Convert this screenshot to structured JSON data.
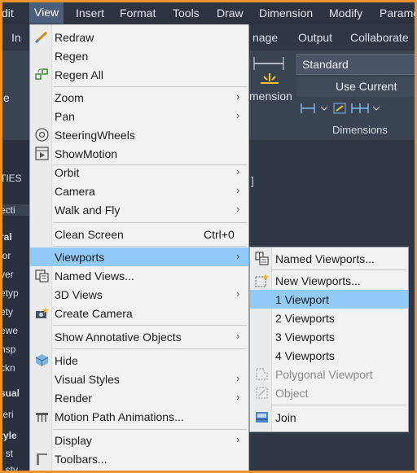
{
  "menubar": {
    "items": [
      "dit",
      "View",
      "Insert",
      "Format",
      "Tools",
      "Draw",
      "Dimension",
      "Modify",
      "Parame"
    ]
  },
  "ribbon_tabs": {
    "items": [
      "In",
      "nage",
      "Output",
      "Collaborate"
    ]
  },
  "ribbon": {
    "style_value": "Standard",
    "layer_value": "Use Current",
    "dimension_label": "mension",
    "panel_label": "Dimensions",
    "left_fragment": "e"
  },
  "left_palette": [
    "TIES",
    "ecti",
    "ral",
    "lor",
    "yer",
    "etyp",
    "ety",
    "ewe",
    "nsp",
    "ckn",
    "sual",
    "teri",
    "tyle",
    "t st",
    "t sty"
  ],
  "view_menu": {
    "items": [
      {
        "label": "Redraw",
        "icon": "redraw-icon"
      },
      {
        "label": "Regen"
      },
      {
        "label": "Regen All",
        "icon": "regen-all-icon"
      },
      {
        "label": "Zoom",
        "submenu": true
      },
      {
        "label": "Pan",
        "submenu": true
      },
      {
        "label": "SteeringWheels",
        "icon": "steeringwheels-icon"
      },
      {
        "label": "ShowMotion",
        "icon": "showmotion-icon"
      },
      {
        "label": "Orbit",
        "submenu": true
      },
      {
        "label": "Camera",
        "submenu": true
      },
      {
        "label": "Walk and Fly",
        "submenu": true
      },
      {
        "label": "Clean Screen",
        "shortcut": "Ctrl+0"
      },
      {
        "label": "Viewports",
        "submenu": true,
        "highlighted": true
      },
      {
        "label": "Named Views...",
        "icon": "named-views-icon"
      },
      {
        "label": "3D Views",
        "submenu": true
      },
      {
        "label": "Create Camera",
        "icon": "create-camera-icon"
      },
      {
        "label": "Show Annotative Objects",
        "submenu": true
      },
      {
        "label": "Hide",
        "icon": "hide-icon"
      },
      {
        "label": "Visual Styles",
        "submenu": true
      },
      {
        "label": "Render",
        "submenu": true
      },
      {
        "label": "Motion Path Animations...",
        "icon": "motion-path-icon"
      },
      {
        "label": "Display",
        "submenu": true
      },
      {
        "label": "Toolbars...",
        "icon": "toolbars-icon"
      }
    ]
  },
  "viewports_submenu": {
    "items": [
      {
        "label": "Named Viewports...",
        "icon": "named-viewports-icon"
      },
      {
        "label": "New Viewports...",
        "icon": "new-viewports-icon"
      },
      {
        "label": "1 Viewport",
        "highlighted": true
      },
      {
        "label": "2 Viewports"
      },
      {
        "label": "3 Viewports"
      },
      {
        "label": "4 Viewports"
      },
      {
        "label": "Polygonal Viewport",
        "disabled": true,
        "icon": "polygonal-viewport-icon"
      },
      {
        "label": "Object",
        "disabled": true,
        "icon": "object-viewport-icon"
      },
      {
        "label": "Join",
        "icon": "join-icon"
      }
    ]
  },
  "colors": {
    "accent_frame": "#f0932c",
    "highlight": "#91c9f7",
    "menu_bg": "#f2f2f2"
  }
}
